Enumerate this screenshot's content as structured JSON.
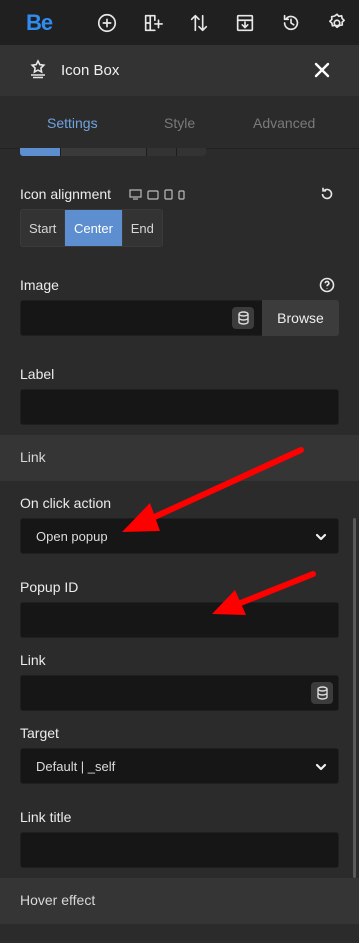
{
  "topbar": {
    "logo": "Be",
    "icons": [
      "add-icon",
      "layout-add-icon",
      "sort-icon",
      "save-icon",
      "history-icon",
      "gear-icon"
    ]
  },
  "panel": {
    "title": "Icon Box",
    "icon": "icon-box-icon",
    "close_icon": "close-icon"
  },
  "tabs": [
    {
      "label": "Settings",
      "active": true
    },
    {
      "label": "Style",
      "active": false
    },
    {
      "label": "Advanced",
      "active": false
    }
  ],
  "icon_alignment": {
    "label": "Icon alignment",
    "devices": [
      "desktop-icon",
      "tablet-landscape-icon",
      "tablet-icon",
      "mobile-icon"
    ],
    "options": [
      "Start",
      "Center",
      "End"
    ],
    "selected": "Center"
  },
  "image": {
    "label": "Image",
    "value": "",
    "browse_label": "Browse"
  },
  "label_field": {
    "label": "Label",
    "value": ""
  },
  "link_section": {
    "title": "Link"
  },
  "on_click_action": {
    "label": "On click action",
    "value": "Open popup"
  },
  "popup_id": {
    "label": "Popup ID",
    "value": ""
  },
  "link": {
    "label": "Link",
    "value": ""
  },
  "target": {
    "label": "Target",
    "value": "Default | _self"
  },
  "link_title": {
    "label": "Link title",
    "value": ""
  },
  "hover_section": {
    "title": "Hover effect"
  },
  "colors": {
    "accent": "#5c8ed0",
    "brand": "#2f8cf0",
    "annotation_arrow": "#ff0000"
  }
}
